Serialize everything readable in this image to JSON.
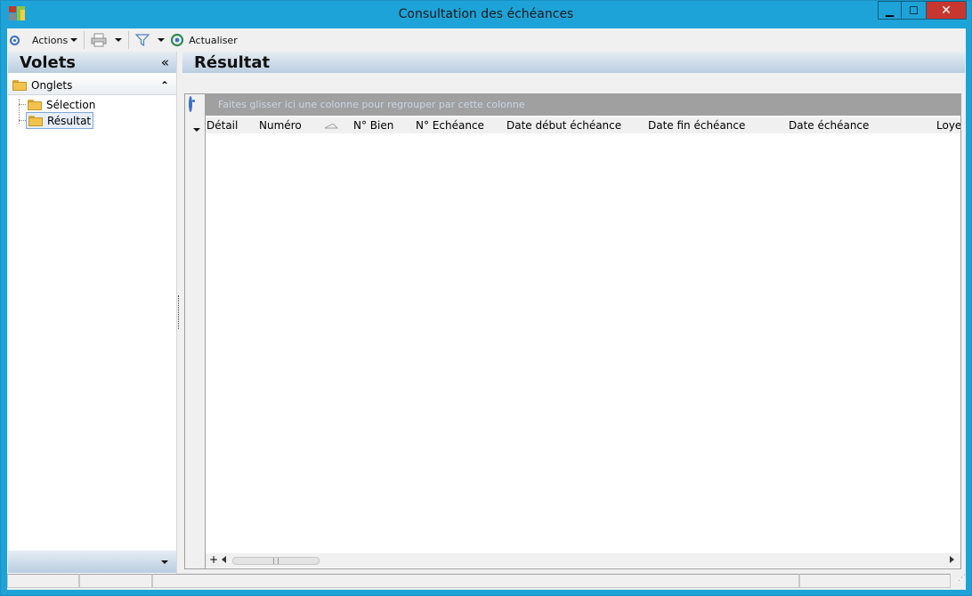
{
  "window": {
    "title": "Consultation des échéances",
    "min_symbol": "▁",
    "max_symbol": "☐",
    "close_symbol": "✕"
  },
  "toolbar": {
    "actions_label": "Actions",
    "refresh_label": "Actualiser"
  },
  "left_pane": {
    "title": "Volets",
    "collapse_symbol": "«",
    "group_label": "Onglets",
    "group_toggle_symbol": "⌃",
    "tree_items": [
      {
        "label": "Sélection",
        "selected": false
      },
      {
        "label": "Résultat",
        "selected": true
      }
    ]
  },
  "right_pane": {
    "title": "Résultat",
    "group_bar_text": "Faites glisser ici une colonne pour regrouper par cette colonne",
    "columns": [
      "Détail",
      "Numéro",
      "N° Bien",
      "N° Echéance",
      "Date début échéance",
      "Date fin échéance",
      "Date échéance",
      "Loyer"
    ],
    "rows": []
  },
  "colors": {
    "titlebar": "#1ea3d8",
    "close_button": "#c7372f",
    "pane_header": "#b9cde0",
    "group_bar": "#a0a0a0"
  }
}
